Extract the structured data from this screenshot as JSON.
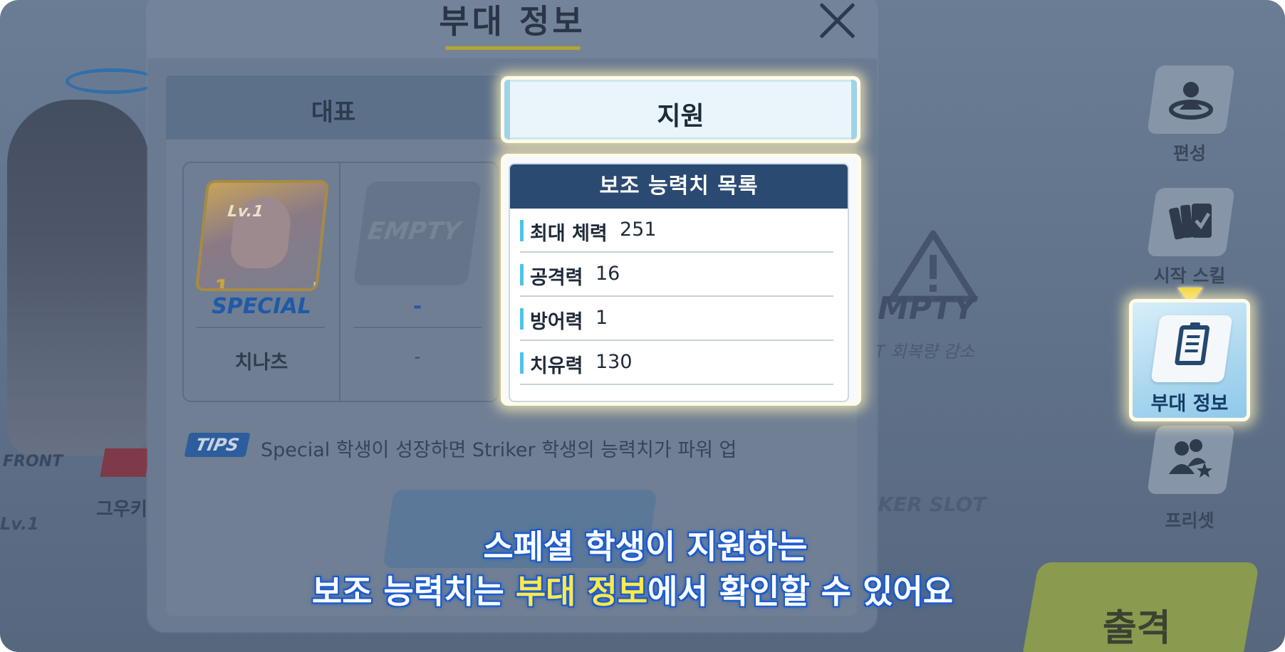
{
  "background": {
    "front_label": "FRONT",
    "front_lv": "Lv.1",
    "front_name": "그우키",
    "empty_text": "MPTY",
    "empty_sub": "T 회복량 감소",
    "striker_slot": "IKER SLOT",
    "sortie_label": "출격"
  },
  "side_menu": {
    "items": [
      {
        "label": "편성",
        "icon": "user-pin-icon"
      },
      {
        "label": "시작 스킬",
        "icon": "cards-check-icon"
      },
      {
        "label": "부대 정보",
        "icon": "clipboard-list-icon"
      },
      {
        "label": "프리셋",
        "icon": "users-star-icon"
      }
    ]
  },
  "dialog": {
    "title": "부대 정보",
    "tabs": [
      {
        "label": "대표"
      },
      {
        "label": "지원"
      }
    ],
    "members": [
      {
        "level": "Lv.1",
        "star": "1",
        "type": "SPECIAL",
        "name": "치나츠"
      },
      {
        "placeholder": "EMPTY",
        "type": "-",
        "name": "-"
      }
    ],
    "stats_panel": {
      "title": "보조 능력치 목록",
      "rows": [
        {
          "name": "최대 체력",
          "value": "251"
        },
        {
          "name": "공격력",
          "value": "16"
        },
        {
          "name": "방어력",
          "value": "1"
        },
        {
          "name": "치유력",
          "value": "130"
        }
      ]
    },
    "tips": {
      "badge": "TIPS",
      "text": "Special 학생이 성장하면 Striker 학생의 능력치가 파워 업"
    }
  },
  "subtitle": {
    "line1": "스페셜 학생이 지원하는",
    "line2_prefix": "보조 능력치는 ",
    "line2_highlight": "부대 정보",
    "line2_suffix": "에서 확인할 수 있어요"
  },
  "colors": {
    "highlight_glow": "#fff0b4",
    "stats_header": "#2a4a72",
    "stat_bar": "#4fc3e8",
    "subtitle_outline": "#1f63d6",
    "subtitle_highlight": "#ffe94a",
    "pointer": "#f2d537"
  }
}
